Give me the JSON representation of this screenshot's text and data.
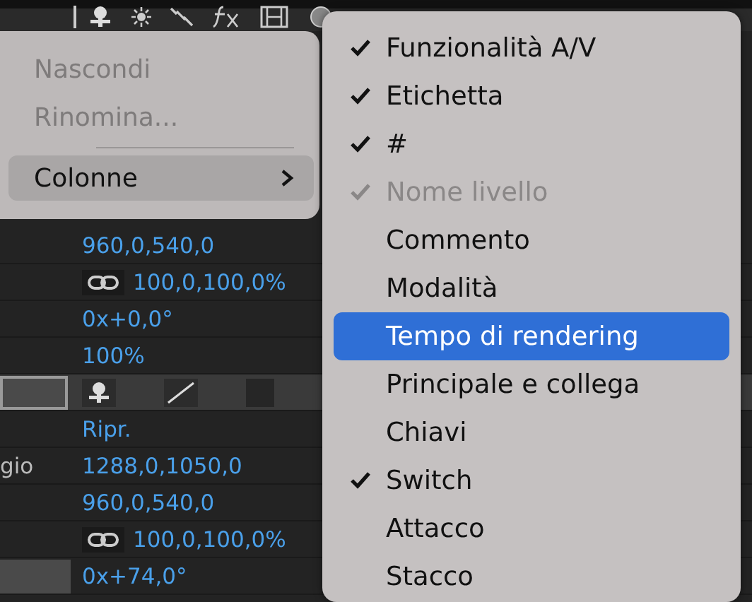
{
  "layer_rows": [
    {
      "kind": "value",
      "value": "960,0,540,0"
    },
    {
      "kind": "linked",
      "value": "100,0,100,0%"
    },
    {
      "kind": "value",
      "value": "0x+0,0°"
    },
    {
      "kind": "value",
      "value": "100%"
    },
    {
      "kind": "switches",
      "switches": [
        {
          "kind": "puppet",
          "on": true
        },
        {
          "kind": "quality",
          "on": true
        },
        {
          "kind": "blank",
          "on": false
        }
      ]
    },
    {
      "kind": "value",
      "value": "Ripr."
    },
    {
      "kind": "value",
      "label": "gio",
      "value": "1288,0,1050,0"
    },
    {
      "kind": "value",
      "value": "960,0,540,0"
    },
    {
      "kind": "linked",
      "value": "100,0,100,0%"
    },
    {
      "kind": "boxed",
      "value": "0x+74,0°"
    }
  ],
  "context_menu": {
    "items": [
      {
        "kind": "item",
        "label": "Nascondi",
        "disabled": true,
        "selected": false
      },
      {
        "kind": "item",
        "label": "Rinomina...",
        "disabled": true,
        "selected": false
      },
      {
        "kind": "separator"
      },
      {
        "kind": "submenu",
        "label": "Colonne",
        "disabled": false,
        "selected": true
      }
    ]
  },
  "columns_submenu": {
    "items": [
      {
        "label": "Funzionalità A/V",
        "checked": true,
        "disabled": false,
        "selected": false
      },
      {
        "label": "Etichetta",
        "checked": true,
        "disabled": false,
        "selected": false
      },
      {
        "label": "#",
        "checked": true,
        "disabled": false,
        "selected": false
      },
      {
        "label": "Nome livello",
        "checked": true,
        "disabled": true,
        "selected": false
      },
      {
        "label": "Commento",
        "checked": false,
        "disabled": false,
        "selected": false
      },
      {
        "label": "Modalità",
        "checked": false,
        "disabled": false,
        "selected": false
      },
      {
        "label": "Tempo di rendering",
        "checked": false,
        "disabled": false,
        "selected": true
      },
      {
        "label": "Principale e collega",
        "checked": false,
        "disabled": false,
        "selected": false
      },
      {
        "label": "Chiavi",
        "checked": false,
        "disabled": false,
        "selected": false
      },
      {
        "label": "Switch",
        "checked": true,
        "disabled": false,
        "selected": false
      },
      {
        "label": "Attacco",
        "checked": false,
        "disabled": false,
        "selected": false
      },
      {
        "label": "Stacco",
        "checked": false,
        "disabled": false,
        "selected": false
      }
    ]
  }
}
